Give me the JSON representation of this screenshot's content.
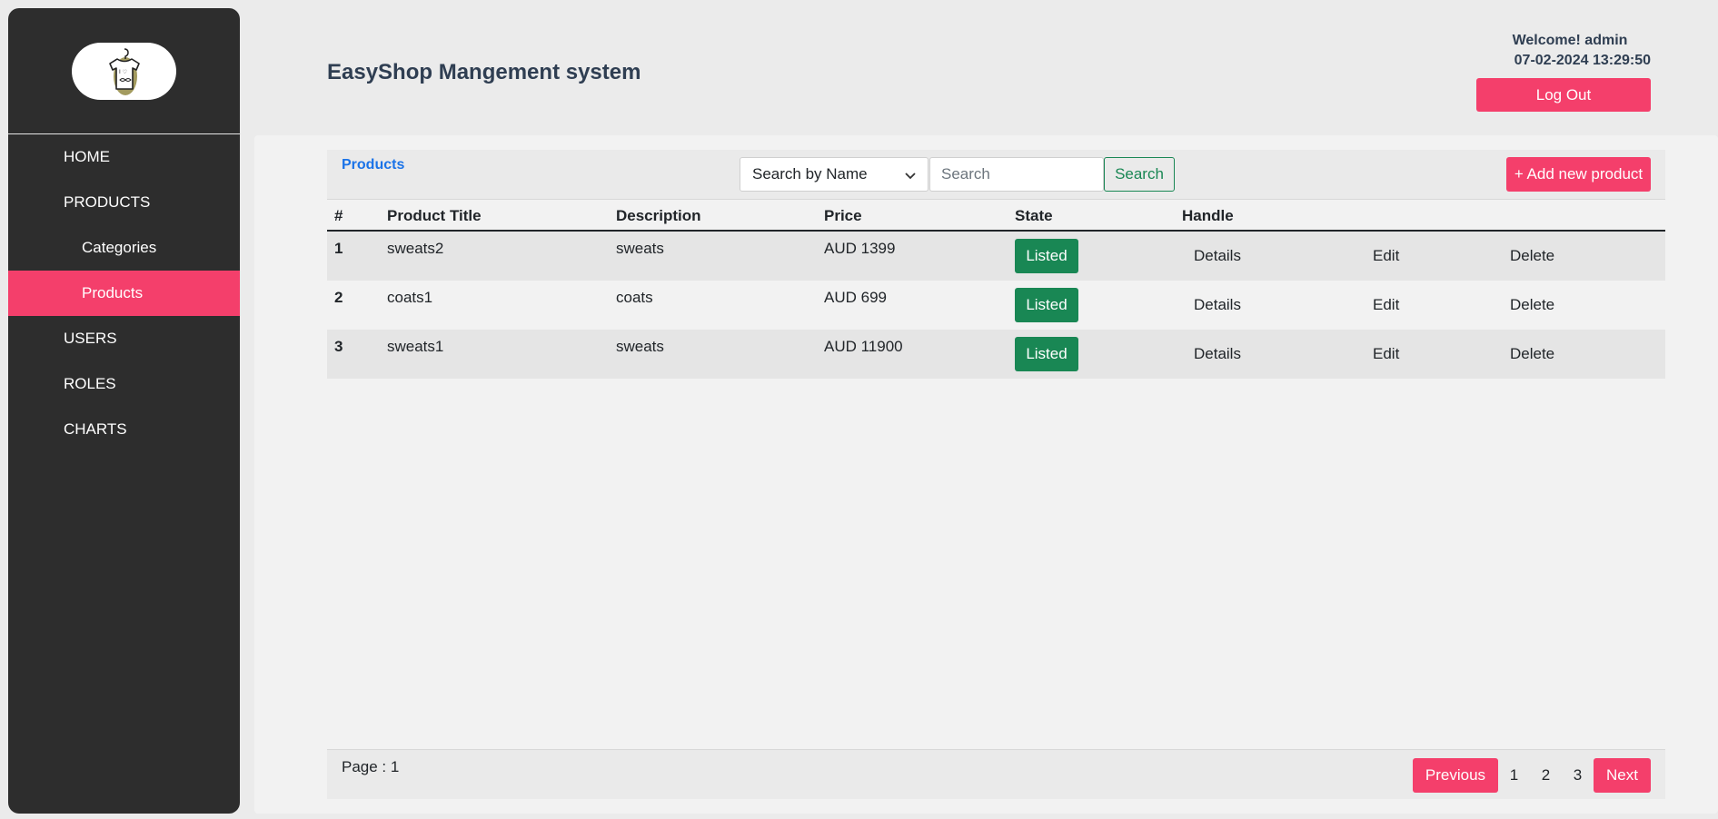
{
  "app": {
    "title": "EasyShop Mangement system",
    "logo_icon": "tshirt-logo-icon"
  },
  "header": {
    "welcome": "Welcome! admin",
    "datetime": "07-02-2024 13:29:50",
    "logout_label": "Log Out"
  },
  "sidebar": {
    "items": [
      {
        "label": "HOME",
        "sub": false,
        "active": false
      },
      {
        "label": "PRODUCTS",
        "sub": false,
        "active": false
      },
      {
        "label": "Categories",
        "sub": true,
        "active": false
      },
      {
        "label": "Products",
        "sub": true,
        "active": true
      },
      {
        "label": "USERS",
        "sub": false,
        "active": false
      },
      {
        "label": "ROLES",
        "sub": false,
        "active": false
      },
      {
        "label": "CHARTS",
        "sub": false,
        "active": false
      }
    ]
  },
  "toolbar": {
    "breadcrumb": "Products",
    "search_by_selected": "Search by Name",
    "search_placeholder": "Search",
    "search_label": "Search",
    "add_label": "+ Add new product"
  },
  "table": {
    "headers": [
      "#",
      "Product Title",
      "Description",
      "Price",
      "State",
      "Handle"
    ],
    "rows": [
      {
        "num": "1",
        "title": "sweats2",
        "description": "sweats",
        "price": "AUD 1399",
        "state": "Listed",
        "details": "Details",
        "edit": "Edit",
        "delete": "Delete"
      },
      {
        "num": "2",
        "title": "coats1",
        "description": "coats",
        "price": "AUD 699",
        "state": "Listed",
        "details": "Details",
        "edit": "Edit",
        "delete": "Delete"
      },
      {
        "num": "3",
        "title": "sweats1",
        "description": "sweats",
        "price": "AUD 11900",
        "state": "Listed",
        "details": "Details",
        "edit": "Edit",
        "delete": "Delete"
      }
    ]
  },
  "footer": {
    "page_label": "Page : 1",
    "previous_label": "Previous",
    "pages": [
      "1",
      "2",
      "3"
    ],
    "next_label": "Next"
  },
  "colors": {
    "accent": "#f43f6b",
    "sidebar_bg": "#2d2d2d",
    "success": "#198754",
    "link": "#1a73e8"
  }
}
